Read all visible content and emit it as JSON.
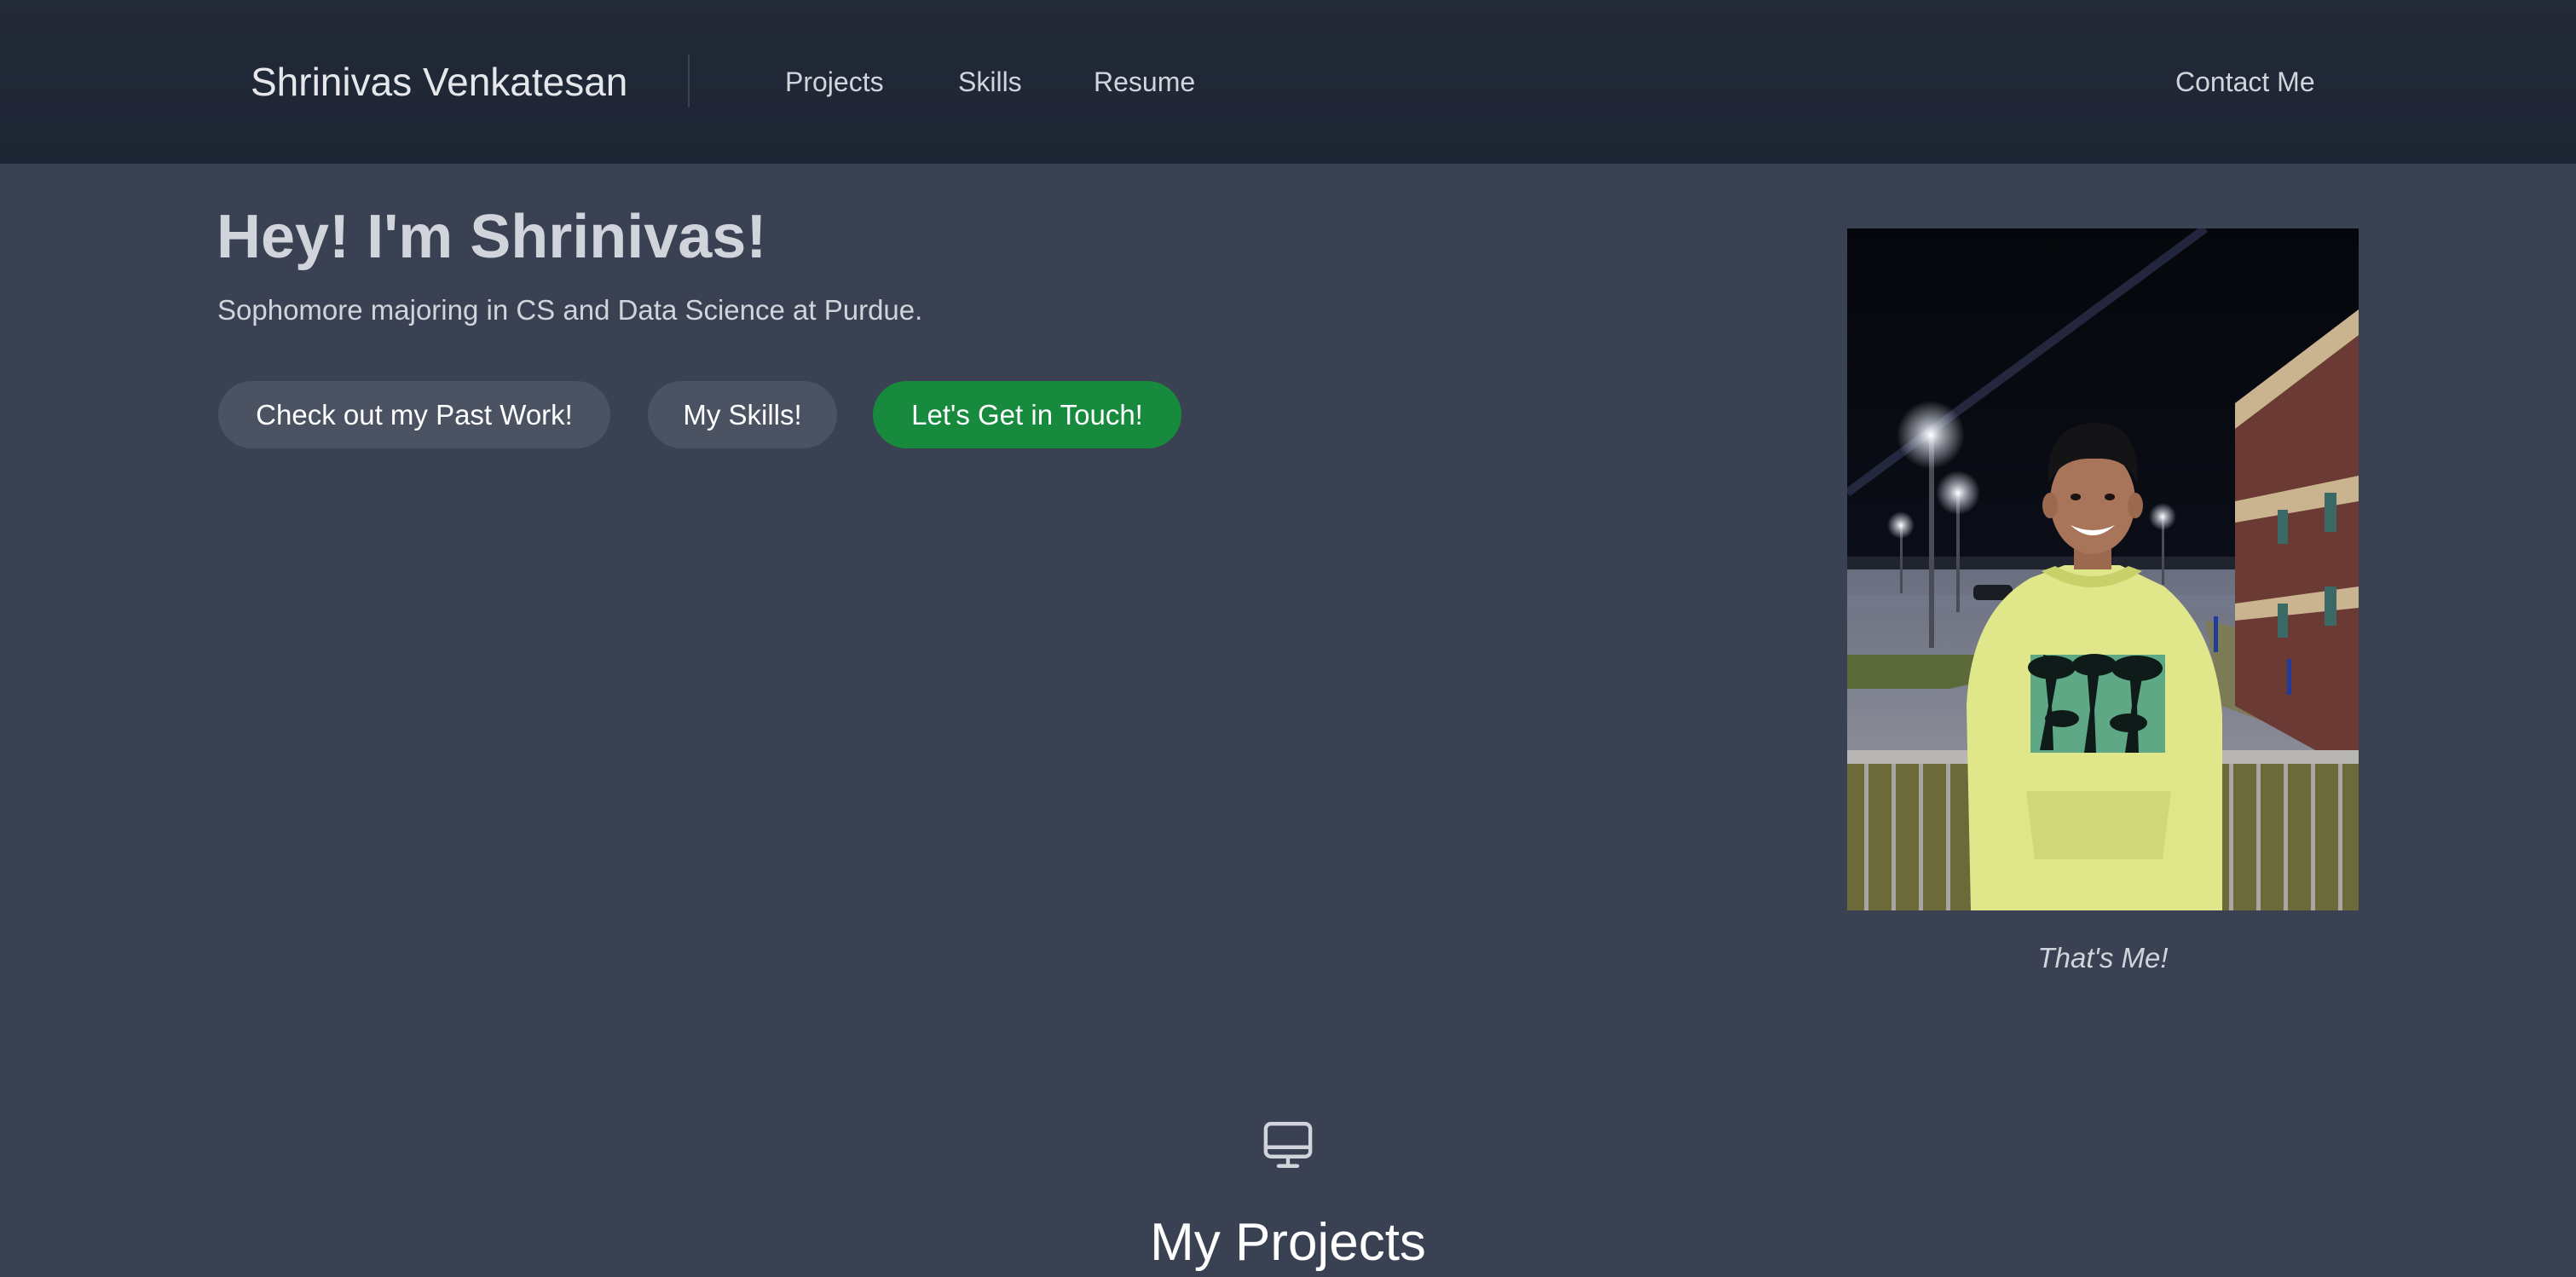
{
  "header": {
    "brand": "Shrinivas Venkatesan",
    "nav": {
      "projects": "Projects",
      "skills": "Skills",
      "resume": "Resume"
    },
    "contact": "Contact Me"
  },
  "hero": {
    "title": "Hey! I'm Shrinivas!",
    "subtitle": "Sophomore majoring in CS and Data Science at Purdue.",
    "buttons": {
      "past_work": "Check out my Past Work!",
      "skills": "My Skills!",
      "touch": "Let's Get in Touch!"
    },
    "photo_caption": "That's Me!"
  },
  "projects_section": {
    "icon": "monitor-icon",
    "title": "My Projects"
  },
  "colors": {
    "page_bg": "#394153",
    "header_bg": "#1f2635",
    "button_gray": "#4b5262",
    "button_green": "#178a3e"
  }
}
